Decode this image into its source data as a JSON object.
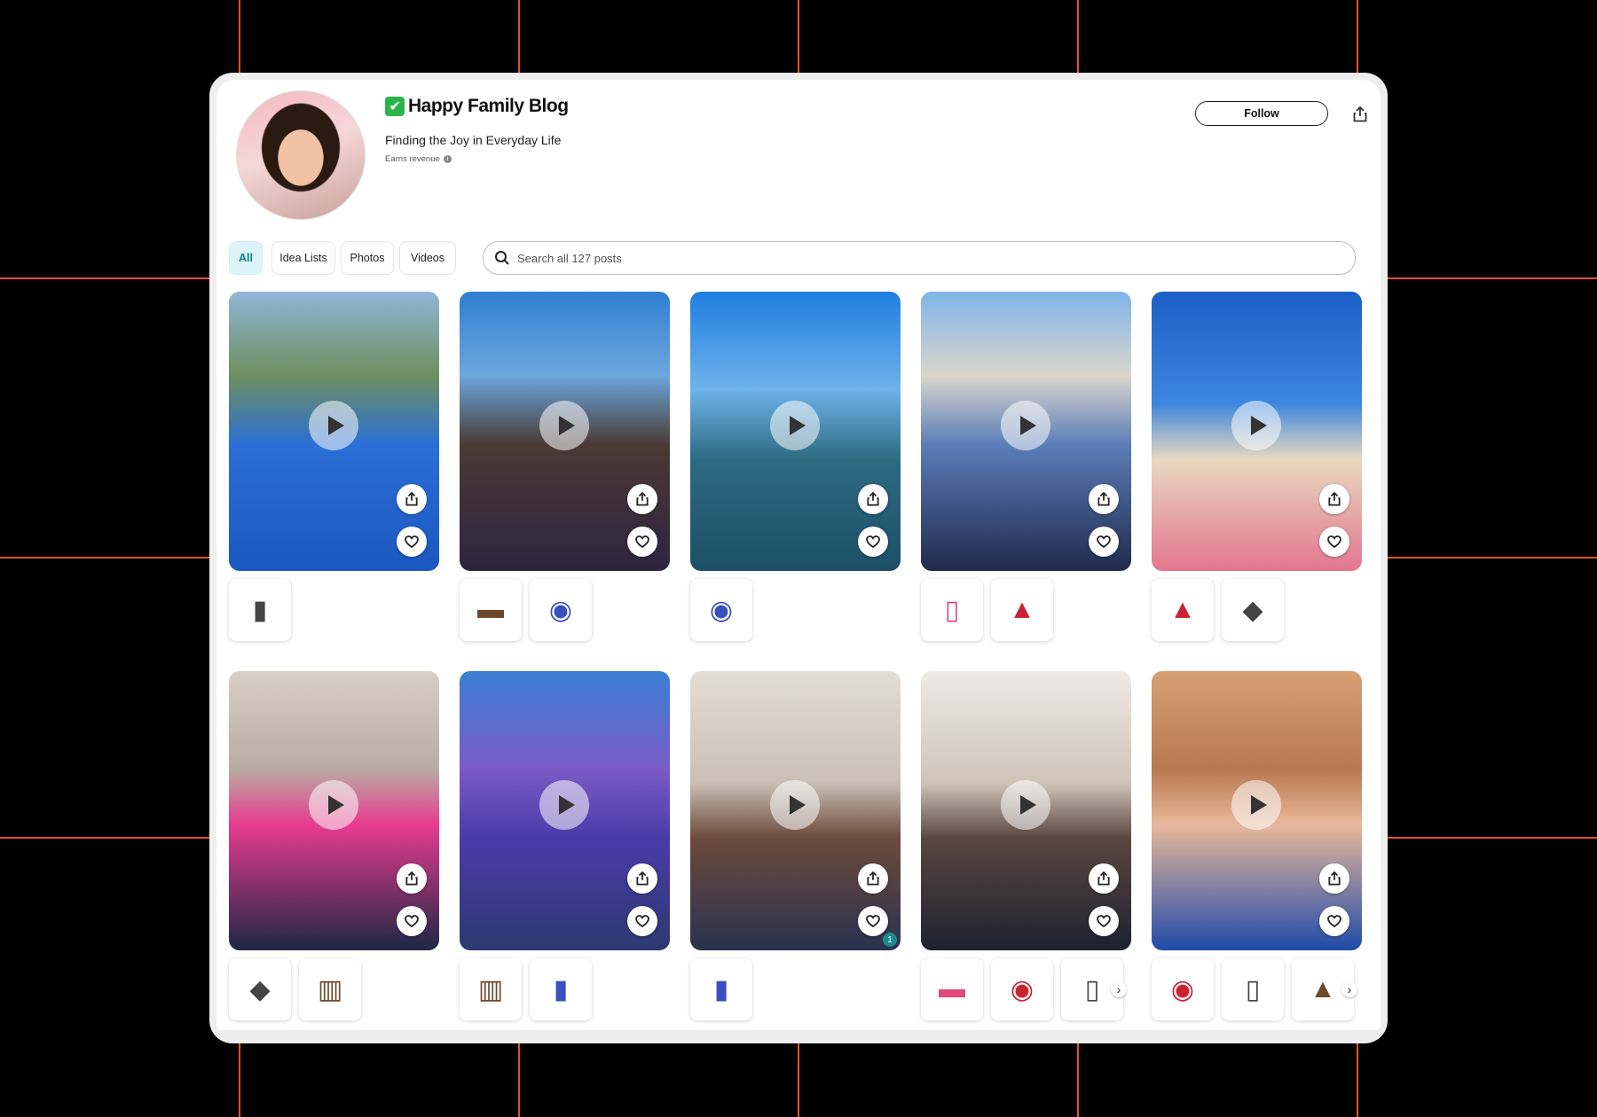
{
  "profile": {
    "name": "Happy Family Blog",
    "verified_glyph": "✔",
    "tagline": "Finding the Joy in Everyday Life",
    "earns": "Earns revenue",
    "info_glyph": "i",
    "follow_label": "Follow"
  },
  "tabs": [
    {
      "label": "All",
      "active": true
    },
    {
      "label": "Idea Lists",
      "active": false
    },
    {
      "label": "Photos",
      "active": false
    },
    {
      "label": "Videos",
      "active": false
    }
  ],
  "search": {
    "placeholder": "Search all 127 posts"
  },
  "posts": [
    {
      "thumbs": 1
    },
    {
      "thumbs": 2
    },
    {
      "thumbs": 1
    },
    {
      "thumbs": 2
    },
    {
      "thumbs": 2
    },
    {
      "thumbs": 2
    },
    {
      "thumbs": 2
    },
    {
      "thumbs": 1,
      "badge": "1"
    },
    {
      "thumbs": 3,
      "more": true
    },
    {
      "thumbs": 3,
      "more": true
    }
  ],
  "more_glyph": "›",
  "colors": {
    "accent": "#0a7f8c",
    "verified": "#2cb34a",
    "badge": "#1a8a8f"
  }
}
